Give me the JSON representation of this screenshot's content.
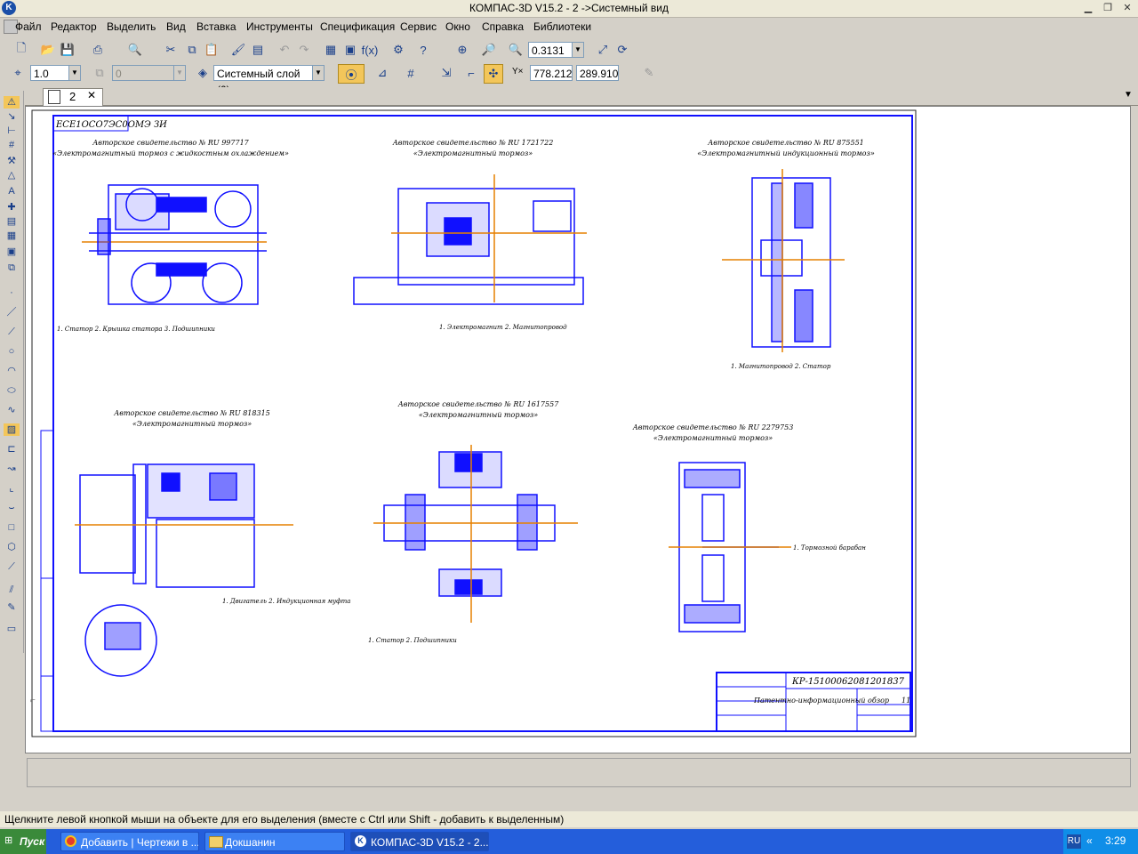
{
  "window": {
    "title": "КОМПАС-3D V15.2  - 2 ->Системный вид"
  },
  "menu": [
    "Файл",
    "Редактор",
    "Выделить",
    "Вид",
    "Вставка",
    "Инструменты",
    "Спецификация",
    "Сервис",
    "Окно",
    "Справка",
    "Библиотеки"
  ],
  "toolbar": {
    "zoom_value": "0.3131",
    "line_scale": "1.0",
    "disabled_field": "0",
    "layer": "Системный слой (0)",
    "coord_x": "778.212",
    "coord_y": "289.910"
  },
  "doc_tab": {
    "label": "2"
  },
  "drawing": {
    "stamp_top": "ЕСЕ1ОСО7ЭС0ОМЭ ЗИ",
    "sections": [
      {
        "cert": "Авторское свидетельство № RU 997717",
        "name": "«Электромагнитный тормоз с жидкостным охлаждением»"
      },
      {
        "cert": "Авторское свидетельство № RU 1721722",
        "name": "«Электромагнитный тормоз»"
      },
      {
        "cert": "Авторское свидетельство № RU 875551",
        "name": "«Электромагнитный индукционный тормоз»"
      },
      {
        "cert": "Авторское свидетельство № RU 818315",
        "name": "«Электромагнитный тормоз»"
      },
      {
        "cert": "Авторское свидетельство № RU 1617557",
        "name": "«Электромагнитный тормоз»"
      },
      {
        "cert": "Авторское свидетельство № RU 2279753",
        "name": "«Электромагнитный тормоз»"
      }
    ],
    "title_block": {
      "code": "КР-15100062081201837",
      "name": "Патентно-информационный обзор",
      "sheet": "11"
    }
  },
  "status": {
    "hint": "Щелкните левой кнопкой мыши на объекте для его выделения (вместе с Ctrl или Shift - добавить к выделенным)"
  },
  "taskbar": {
    "start": "Пуск",
    "tasks": [
      "Добавить | Чертежи в ...",
      "Докшанин",
      "КОМПАС-3D V15.2 - 2..."
    ],
    "lang": "RU",
    "time": "3:29"
  }
}
